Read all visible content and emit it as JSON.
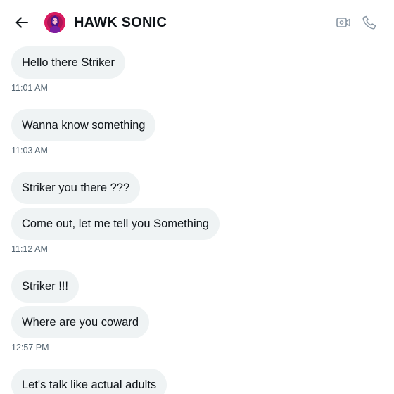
{
  "header": {
    "title": "HAWK SONIC",
    "back_icon": "arrow-left-icon",
    "video_icon": "video-call-icon",
    "phone_icon": "phone-call-icon"
  },
  "messages": [
    {
      "text": "Hello there Striker"
    },
    {
      "text": "Wanna know something"
    },
    {
      "text": "Striker you there ???"
    },
    {
      "text": "Come out, let me tell you Something"
    },
    {
      "text": "Striker !!!"
    },
    {
      "text": "Where are you coward"
    },
    {
      "text": "Let's talk like actual adults"
    }
  ],
  "timestamps": [
    "11:01 AM",
    "11:03 AM",
    "11:12 AM",
    "12:57 PM"
  ],
  "colors": {
    "bubble_bg": "#eff3f4",
    "text": "#0f1419",
    "secondary_text": "#536471",
    "icon_gray": "#8b98a5"
  }
}
